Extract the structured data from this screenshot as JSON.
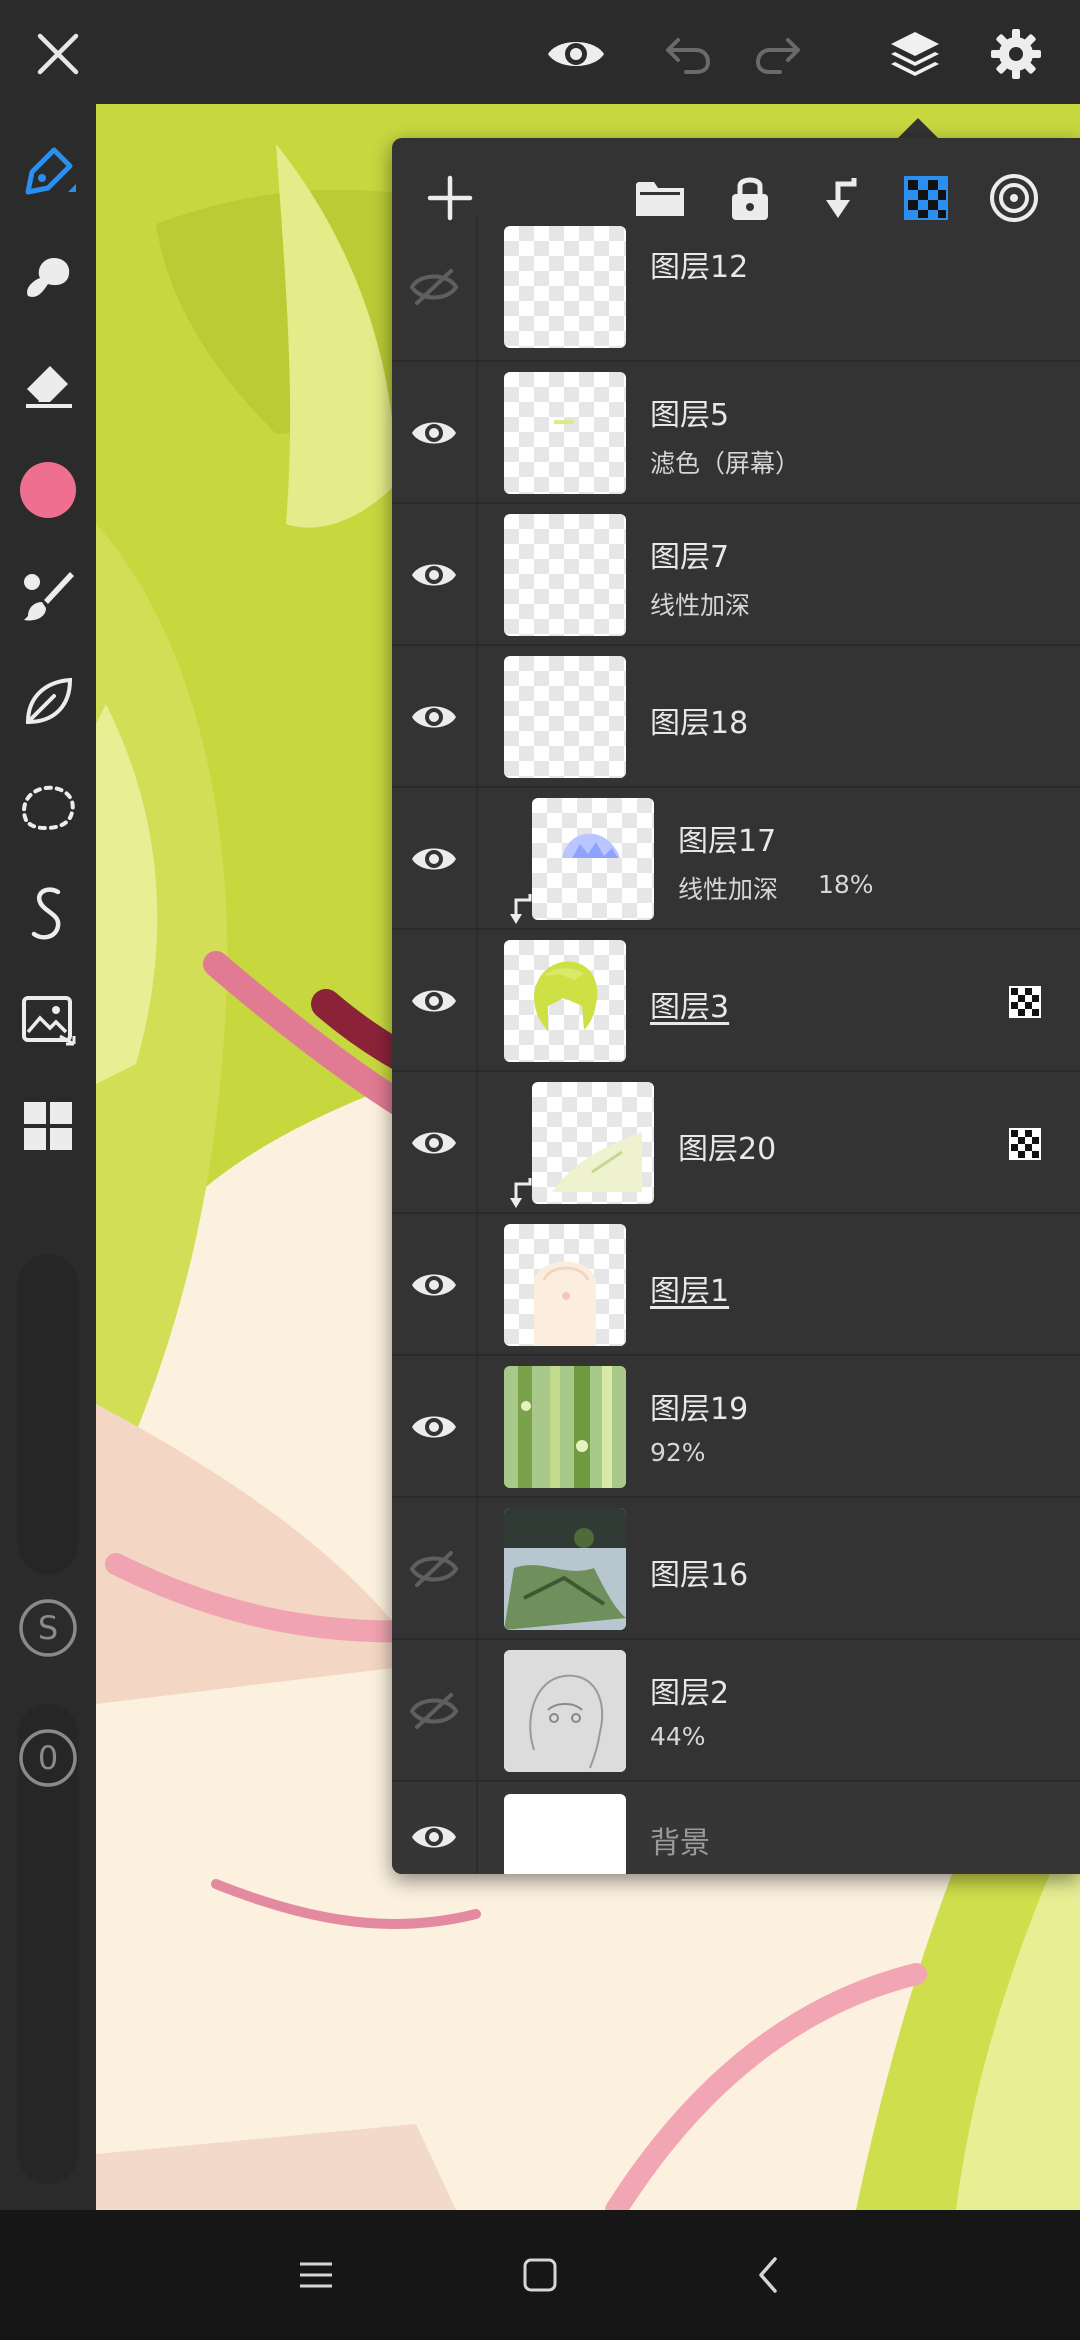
{
  "topbar": {
    "icons": [
      "close-icon",
      "eye-icon",
      "undo-icon",
      "redo-icon",
      "layers-icon",
      "gear-icon"
    ]
  },
  "toolbar": {
    "tools": [
      "pen-icon",
      "smudge-icon",
      "eraser-icon",
      "color-swatch",
      "brush-settings-icon",
      "leaf-fill-icon",
      "lasso-icon",
      "curve-icon",
      "image-transform-icon",
      "grid-materials-icon"
    ],
    "color": "#ee6f8f",
    "size_badge": "S",
    "opacity_badge": "0"
  },
  "layer_panel": {
    "header_icons": [
      "add-icon",
      "folder-icon",
      "lock-icon",
      "merge-down-icon",
      "alpha-lock-icon",
      "reference-icon"
    ],
    "accent": "#2b8ff0",
    "layers": [
      {
        "name": "图层12",
        "sub": "",
        "visible": false
      },
      {
        "name": "图层5",
        "sub": "滤色（屏幕）",
        "visible": true
      },
      {
        "name": "图层7",
        "sub": "线性加深",
        "visible": true
      },
      {
        "name": "图层18",
        "sub": "",
        "visible": true
      },
      {
        "name": "图层17",
        "sub": "线性加深",
        "opacity": "18%",
        "visible": true,
        "clipped": true
      },
      {
        "name": "图层3",
        "sub": "",
        "visible": true,
        "alpha_locked": true,
        "underlined": true
      },
      {
        "name": "图层20",
        "sub": "",
        "visible": true,
        "clipped": true,
        "alpha_locked": true
      },
      {
        "name": "图层1",
        "sub": "",
        "visible": true,
        "underlined": true
      },
      {
        "name": "图层19",
        "sub": "92%",
        "visible": true
      },
      {
        "name": "图层16",
        "sub": "",
        "visible": false
      },
      {
        "name": "图层2",
        "sub": "44%",
        "visible": false
      },
      {
        "name": "背景",
        "sub": "",
        "visible": true
      }
    ]
  },
  "navbar": {
    "icons": [
      "menu-icon",
      "home-icon",
      "back-icon"
    ]
  }
}
